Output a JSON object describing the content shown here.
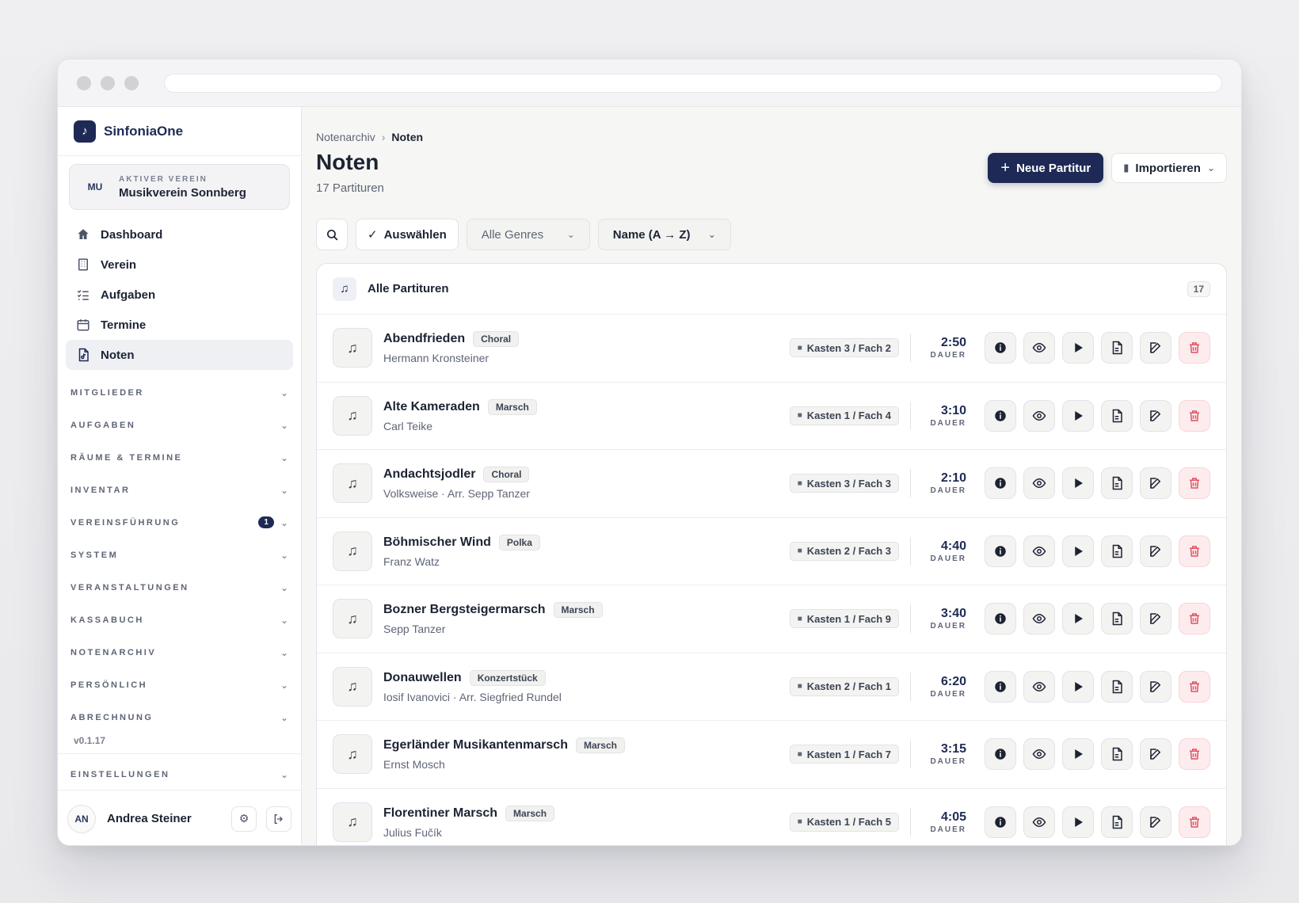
{
  "brand": {
    "name": "SinfoniaOne",
    "logo_glyph": "♪"
  },
  "club": {
    "initials": "MU",
    "label": "AKTIVER VEREIN",
    "name": "Musikverein Sonnberg"
  },
  "nav": [
    {
      "label": "Dashboard",
      "icon": "home-icon"
    },
    {
      "label": "Verein",
      "icon": "building-icon"
    },
    {
      "label": "Aufgaben",
      "icon": "tasks-icon"
    },
    {
      "label": "Termine",
      "icon": "calendar-icon"
    },
    {
      "label": "Noten",
      "icon": "file-music-icon",
      "active": true
    }
  ],
  "sections": [
    {
      "label": "MITGLIEDER"
    },
    {
      "label": "AUFGABEN"
    },
    {
      "label": "RÄUME & TERMINE"
    },
    {
      "label": "INVENTAR"
    },
    {
      "label": "VEREINSFÜHRUNG",
      "badge": "1"
    },
    {
      "label": "SYSTEM"
    },
    {
      "label": "VERANSTALTUNGEN"
    },
    {
      "label": "KASSABUCH"
    },
    {
      "label": "NOTENARCHIV"
    },
    {
      "label": "PERSÖNLICH"
    },
    {
      "label": "ABRECHNUNG"
    }
  ],
  "version": "v0.1.17",
  "settings_section": "EINSTELLUNGEN",
  "user": {
    "initials": "AN",
    "name": "Andrea Steiner"
  },
  "breadcrumb": {
    "parent": "Notenarchiv",
    "current": "Noten"
  },
  "page": {
    "title": "Noten",
    "subtitle": "17 Partituren"
  },
  "actions": {
    "new_label": "Neue Partitur",
    "import_label": "Importieren"
  },
  "toolbar": {
    "select_label": "Auswählen",
    "genre_label": "Alle Genres",
    "sort_label": "Name (A → Z)"
  },
  "list": {
    "title": "Alle Partituren",
    "count": "17",
    "duration_label": "DAUER",
    "rows": [
      {
        "title": "Abendfrieden",
        "genre": "Choral",
        "composer": "Hermann Kronsteiner",
        "location": "Kasten 3 / Fach 2",
        "duration": "2:50"
      },
      {
        "title": "Alte Kameraden",
        "genre": "Marsch",
        "composer": "Carl Teike",
        "location": "Kasten 1 / Fach 4",
        "duration": "3:10"
      },
      {
        "title": "Andachtsjodler",
        "genre": "Choral",
        "composer": "Volksweise · Arr. Sepp Tanzer",
        "location": "Kasten 3 / Fach 3",
        "duration": "2:10"
      },
      {
        "title": "Böhmischer Wind",
        "genre": "Polka",
        "composer": "Franz Watz",
        "location": "Kasten 2 / Fach 3",
        "duration": "4:40"
      },
      {
        "title": "Bozner Bergsteigermarsch",
        "genre": "Marsch",
        "composer": "Sepp Tanzer",
        "location": "Kasten 1 / Fach 9",
        "duration": "3:40"
      },
      {
        "title": "Donauwellen",
        "genre": "Konzertstück",
        "composer": "Iosif Ivanovici · Arr. Siegfried Rundel",
        "location": "Kasten 2 / Fach 1",
        "duration": "6:20"
      },
      {
        "title": "Egerländer Musikantenmarsch",
        "genre": "Marsch",
        "composer": "Ernst Mosch",
        "location": "Kasten 1 / Fach 7",
        "duration": "3:15"
      },
      {
        "title": "Florentiner Marsch",
        "genre": "Marsch",
        "composer": "Julius Fučík",
        "location": "Kasten 1 / Fach 5",
        "duration": "4:05"
      }
    ]
  },
  "colors": {
    "primary": "#1e2a55",
    "danger": "#e05263",
    "main_bg": "#f6f6f4"
  }
}
